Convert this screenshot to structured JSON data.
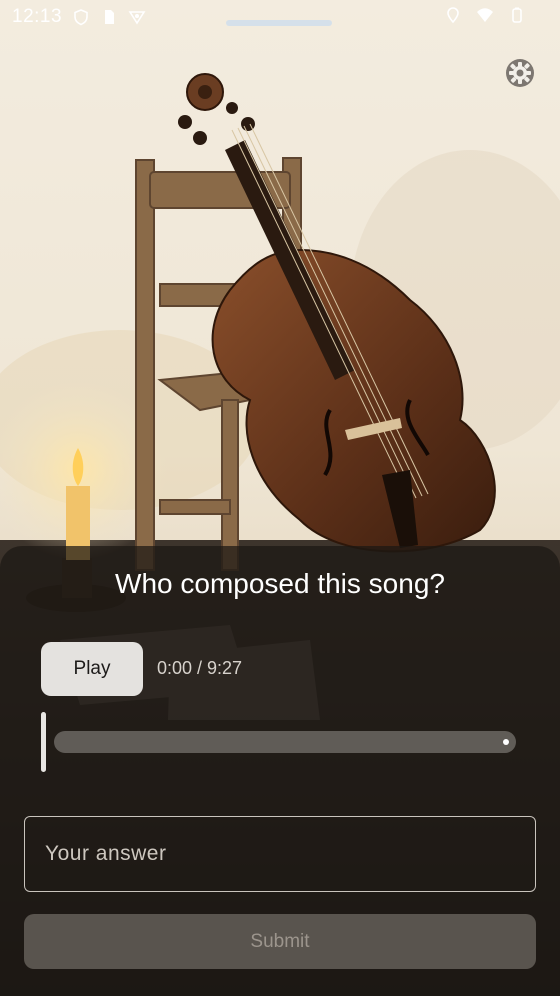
{
  "status_bar": {
    "time": "12:13",
    "left_icons": [
      "shield-icon",
      "sim-card-icon",
      "vpn-key-icon"
    ],
    "right_icons": [
      "location-icon",
      "wifi-icon",
      "battery-icon"
    ]
  },
  "settings": {
    "icon": "gear-icon"
  },
  "quiz": {
    "question": "Who composed this song?",
    "play_label": "Play",
    "time_readout": "0:00 / 9:27",
    "progress": 0.0,
    "answer_placeholder": "Your answer",
    "answer_value": "",
    "submit_label": "Submit"
  },
  "colors": {
    "sheet_overlay": "#1c1814",
    "play_button": "#e4e2df",
    "submit_disabled": "#6e6862"
  }
}
